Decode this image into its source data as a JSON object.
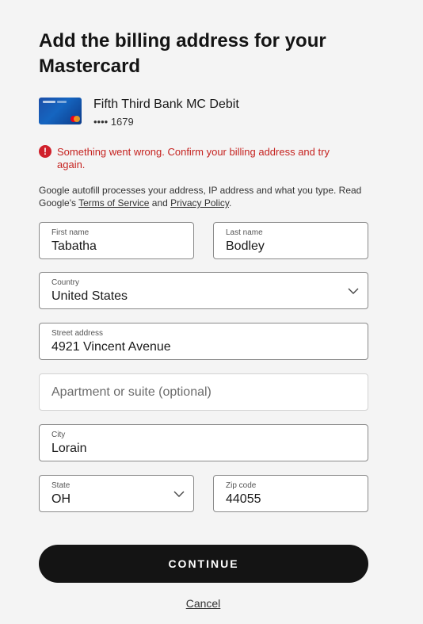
{
  "header": {
    "title": "Add the billing address for your Mastercard"
  },
  "card": {
    "name": "Fifth Third Bank MC Debit",
    "number_masked": "•••• 1679",
    "brand_colors": [
      "#eb001b",
      "#f79e1b"
    ]
  },
  "error": {
    "icon": "!",
    "message": "Something went wrong. Confirm your billing address and try again.",
    "color": "#c5221f"
  },
  "info": {
    "prefix": "Google autofill processes your address, IP address and what you type. Read Google's ",
    "terms_link": "Terms of Service",
    "and": " and ",
    "privacy_link": "Privacy Policy",
    "suffix": "."
  },
  "form": {
    "first_name": {
      "label": "First name",
      "value": "Tabatha"
    },
    "last_name": {
      "label": "Last name",
      "value": "Bodley"
    },
    "country": {
      "label": "Country",
      "value": "United States"
    },
    "street": {
      "label": "Street address",
      "value": "4921 Vincent Avenue"
    },
    "apartment": {
      "placeholder": "Apartment or suite (optional)",
      "value": ""
    },
    "city": {
      "label": "City",
      "value": "Lorain"
    },
    "state": {
      "label": "State",
      "value": "OH"
    },
    "zip": {
      "label": "Zip code",
      "value": "44055"
    }
  },
  "actions": {
    "continue_label": "CONTINUE",
    "cancel_label": "Cancel"
  },
  "icons": {
    "error": "alert-circle-icon",
    "dropdown": "chevron-down-icon"
  }
}
